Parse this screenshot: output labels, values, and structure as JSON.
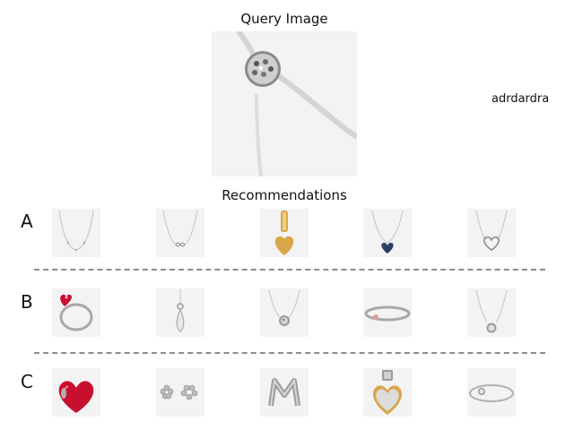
{
  "query": {
    "title": "Query Image",
    "image_icon": "pave-pendant-necklace-closeup"
  },
  "side_note": "adrdardra",
  "recommendations": {
    "title": "Recommendations",
    "rows": [
      {
        "label": "A",
        "items": [
          {
            "icon": "delicate-station-necklace"
          },
          {
            "icon": "infinity-necklace"
          },
          {
            "icon": "gold-heart-bar-charm"
          },
          {
            "icon": "blue-heart-pendant-necklace"
          },
          {
            "icon": "open-heart-necklace"
          }
        ]
      },
      {
        "label": "B",
        "items": [
          {
            "icon": "red-heart-ring"
          },
          {
            "icon": "drop-pendant-charm"
          },
          {
            "icon": "round-pave-pendant-necklace"
          },
          {
            "icon": "snake-chain-bracelet"
          },
          {
            "icon": "sparkling-pendant-necklace"
          }
        ]
      },
      {
        "label": "C",
        "items": [
          {
            "icon": "red-heart-charm"
          },
          {
            "icon": "flower-stud-earrings"
          },
          {
            "icon": "letter-m-charm"
          },
          {
            "icon": "two-tone-heart-dangle-charm"
          },
          {
            "icon": "bangle-bracelet"
          }
        ]
      }
    ]
  },
  "colors": {
    "thumb_bg": "#f3f3f3",
    "silver": "#a8a8a8",
    "gold": "#d9a64a",
    "red": "#c8102e",
    "blue": "#2b3f66",
    "divider": "#8c8c8c"
  }
}
